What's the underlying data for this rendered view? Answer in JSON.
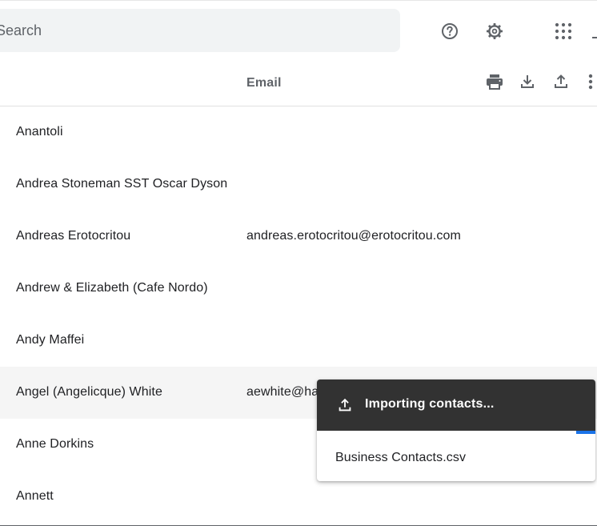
{
  "search": {
    "placeholder": "Search",
    "value": ""
  },
  "toolbar": {
    "icons": [
      "help-icon",
      "gear-icon",
      "apps-grid-icon"
    ]
  },
  "columns": {
    "email": "Email"
  },
  "list_actions": {
    "icons": [
      "print-icon",
      "download-icon",
      "upload-icon",
      "more-vert-icon"
    ]
  },
  "contacts": [
    {
      "name": "Anantoli",
      "email": ""
    },
    {
      "name": "Andrea Stoneman SST Oscar Dyson",
      "email": ""
    },
    {
      "name": "Andreas Erotocritou",
      "email": "andreas.erotocritou@erotocritou.com"
    },
    {
      "name": "Andrew & Elizabeth (Cafe Nordo)",
      "email": ""
    },
    {
      "name": "Andy Maffei",
      "email": ""
    },
    {
      "name": "Angel (Angelicque) White",
      "email": "aewhite@ha"
    },
    {
      "name": "Anne Dorkins",
      "email": ""
    },
    {
      "name": "Annett",
      "email": ""
    }
  ],
  "import_toast": {
    "title": "Importing contacts...",
    "file_name": "Business Contacts.csv",
    "icon": "upload-icon",
    "progress": 0.07
  },
  "colors": {
    "accent": "#1a73e8",
    "toast_bg": "#323232",
    "row_highlight": "#f5f5f5",
    "icon_gray": "#5f6368"
  }
}
